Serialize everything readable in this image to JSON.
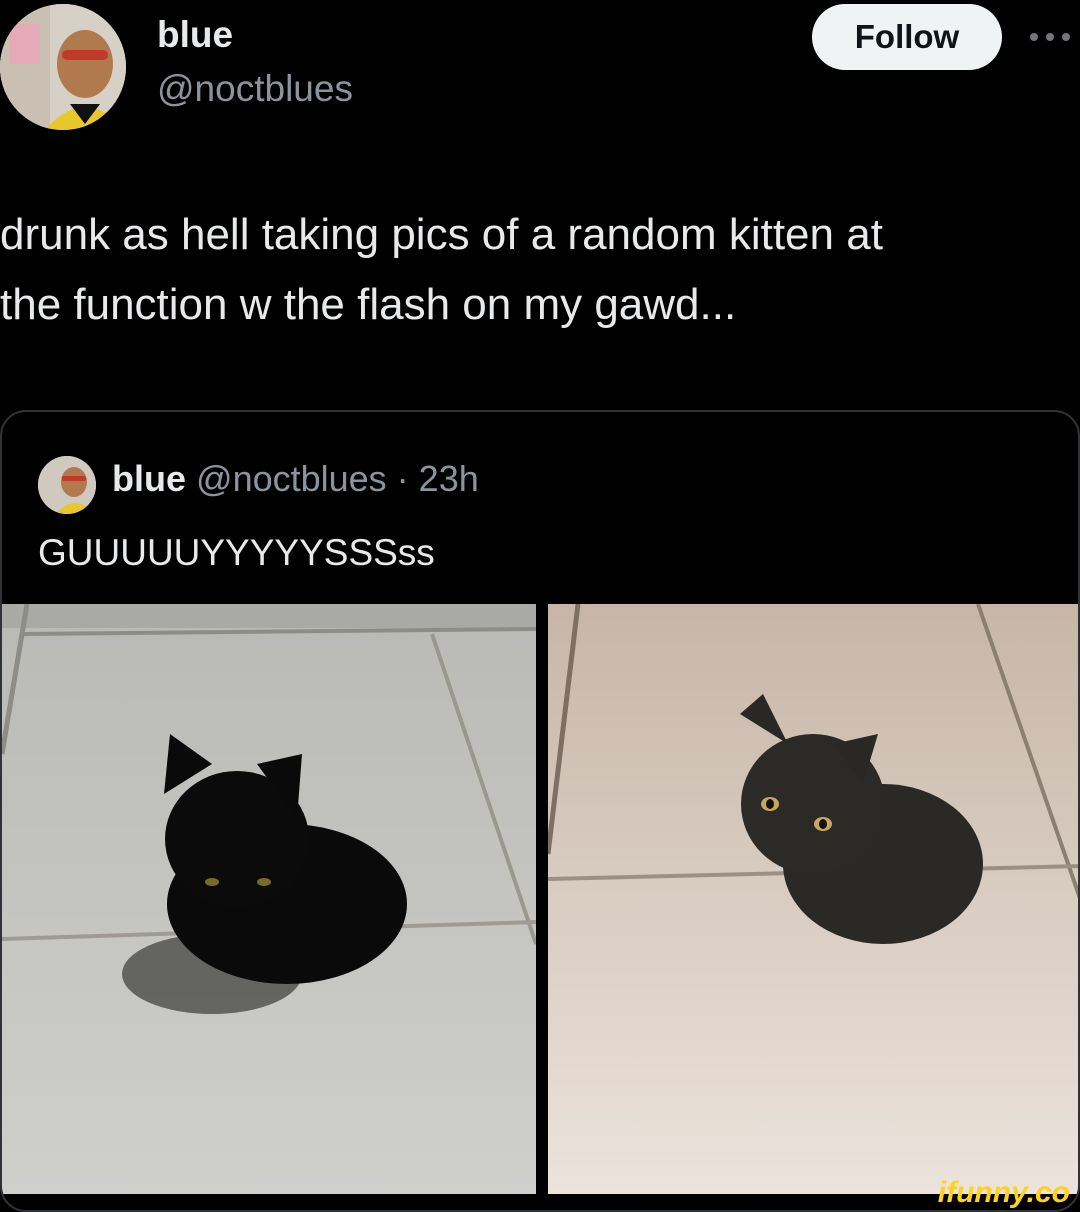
{
  "post": {
    "author": {
      "name": "blue",
      "handle": "@noctblues"
    },
    "follow_label": "Follow",
    "text_line1": "drunk as hell taking pics of a random kitten at",
    "text_line2": "the function w the flash on my gawd..."
  },
  "quoted": {
    "author_name": "blue",
    "handle_time": "@noctblues · 23h",
    "text": "GUUUUUYYYYYSSSss",
    "images": [
      {
        "icon": "kitten-photo-dark"
      },
      {
        "icon": "kitten-photo-flash"
      }
    ]
  },
  "watermark": "ifunny.co",
  "colors": {
    "background": "#000000",
    "text": "#e7e9ea",
    "secondary": "#8b949e",
    "follow_bg": "#eff3f4",
    "watermark": "#ffd21f"
  }
}
